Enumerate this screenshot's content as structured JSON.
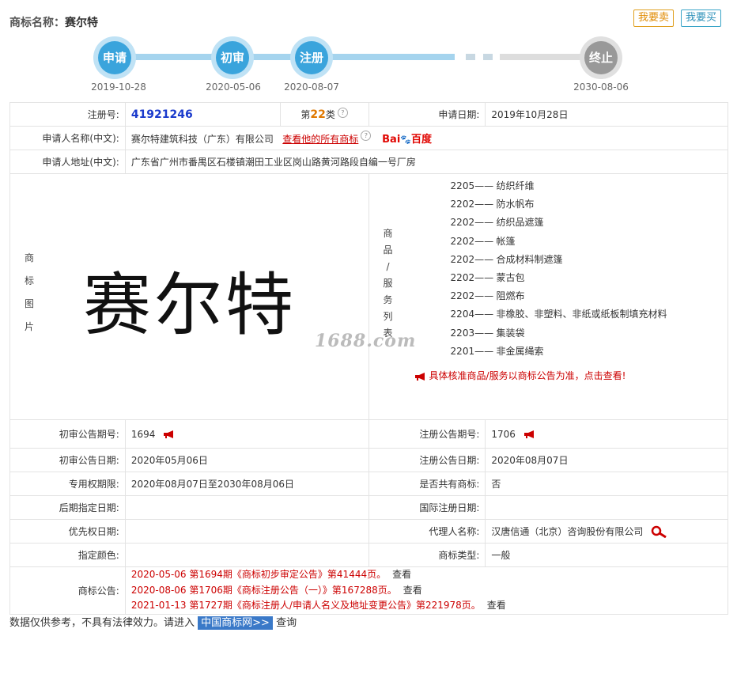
{
  "header": {
    "title_prefix": "商标名称：",
    "title_name": "赛尔特",
    "sell_label": "我要卖",
    "buy_label": "我要买"
  },
  "timeline": {
    "steps": [
      {
        "label": "申请",
        "date": "2019-10-28"
      },
      {
        "label": "初审",
        "date": "2020-05-06"
      },
      {
        "label": "注册",
        "date": "2020-08-07"
      },
      {
        "label": "终止",
        "date": "2030-08-06"
      }
    ]
  },
  "info": {
    "reg_no_label": "注册号:",
    "reg_no": "41921246",
    "class_prefix": "第",
    "class_num": "22",
    "class_suffix": "类",
    "apply_date_label": "申请日期:",
    "apply_date": "2019年10月28日",
    "applicant_label": "申请人名称(中文):",
    "applicant": "赛尔特建筑科技（广东）有限公司",
    "view_all_link": "查看他的所有商标",
    "baidu_text": "Bai",
    "baidu_cn": "百度",
    "address_label": "申请人地址(中文):",
    "address": "广东省广州市番禺区石楼镇潮田工业区岗山路黄河路段自编一号厂房",
    "image_label": [
      "商",
      "标",
      "图",
      "片"
    ],
    "trademark_image_text": "赛尔特",
    "goods_label": [
      "商",
      "品",
      "/",
      "服",
      "务",
      "列",
      "表"
    ],
    "goods": [
      {
        "code": "2205——",
        "name": "纺织纤维"
      },
      {
        "code": "2202——",
        "name": "防水帆布"
      },
      {
        "code": "2202——",
        "name": "纺织品遮篷"
      },
      {
        "code": "2202——",
        "name": "帐篷"
      },
      {
        "code": "2202——",
        "name": "合成材料制遮篷"
      },
      {
        "code": "2202——",
        "name": "蒙古包"
      },
      {
        "code": "2202——",
        "name": "阻燃布"
      },
      {
        "code": "2204——",
        "name": "非橡胶、非塑料、非纸或纸板制填充材料"
      },
      {
        "code": "2203——",
        "name": "集装袋"
      },
      {
        "code": "2201——",
        "name": "非金属绳索"
      }
    ],
    "goods_notice": "具体核准商品/服务以商标公告为准，点击查看!",
    "watermark": "1688.com",
    "prelim_no_label": "初审公告期号:",
    "prelim_no": "1694",
    "reg_pub_no_label": "注册公告期号:",
    "reg_pub_no": "1706",
    "prelim_date_label": "初审公告日期:",
    "prelim_date": "2020年05月06日",
    "reg_pub_date_label": "注册公告日期:",
    "reg_pub_date": "2020年08月07日",
    "right_period_label": "专用权期限:",
    "right_period": "2020年08月07日至2030年08月06日",
    "shared_label": "是否共有商标:",
    "shared": "否",
    "later_label": "后期指定日期:",
    "later": "",
    "intl_label": "国际注册日期:",
    "intl": "",
    "priority_label": "优先权日期:",
    "priority": "",
    "agent_label": "代理人名称:",
    "agent": "汉唐信通（北京）咨询股份有限公司",
    "color_label": "指定颜色:",
    "color": "",
    "tm_type_label": "商标类型:",
    "tm_type": "一般",
    "announce_label": "商标公告:",
    "announcements": [
      {
        "text": "2020-05-06 第1694期《商标初步审定公告》第41444页。",
        "view": "查看"
      },
      {
        "text": "2020-08-06 第1706期《商标注册公告（一）》第167288页。",
        "view": "查看"
      },
      {
        "text": "2021-01-13 第1727期《商标注册人/申请人名义及地址变更公告》第221978页。",
        "view": "查看"
      }
    ]
  },
  "footer": {
    "prefix": "数据仅供参考，不具有法律效力。请进入 ",
    "link": "中国商标网>>",
    "suffix": " 查询"
  },
  "colors": {
    "accent": "#3aa4dc",
    "red": "#cc0000",
    "link_blue": "#1a3acc"
  }
}
